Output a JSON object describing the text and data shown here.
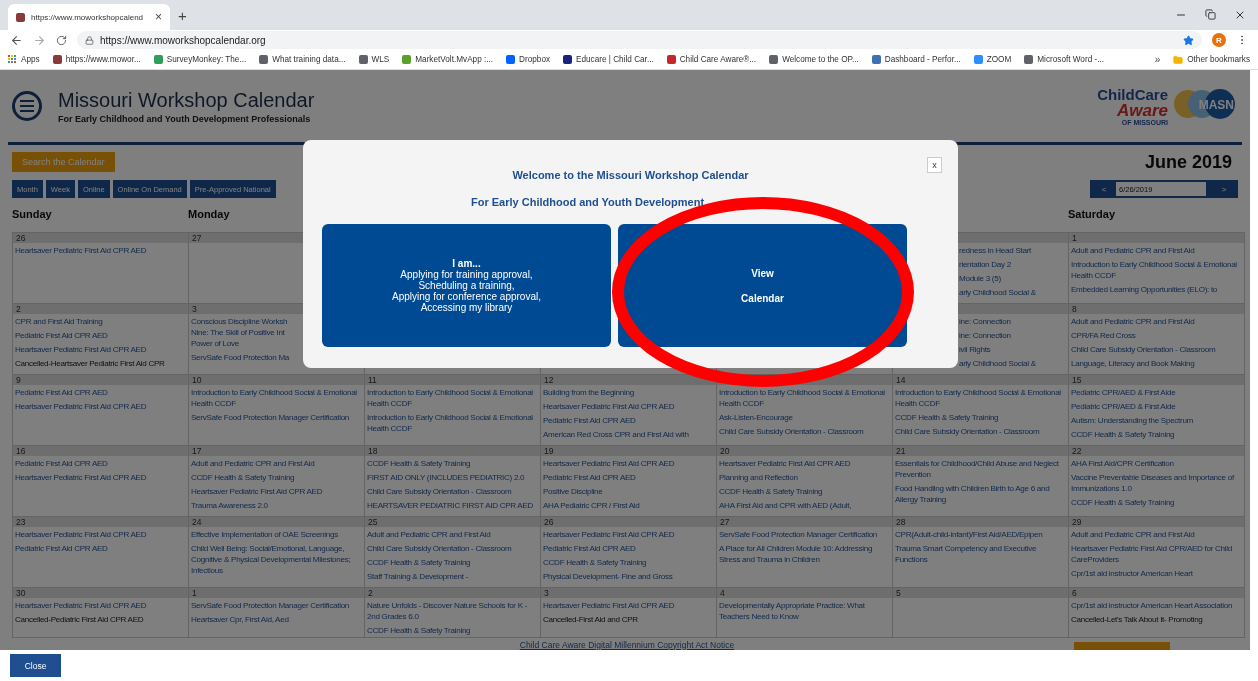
{
  "browser": {
    "tab_title": "https://www.moworkshopcalend",
    "tab_close": "×",
    "new_tab": "+",
    "url": "https://www.moworkshopcalendar.org",
    "avatar": "R",
    "apps": "Apps",
    "more": "»",
    "other_bookmarks": "Other bookmarks",
    "bookmarks": [
      {
        "label": "https://www.mowor...",
        "color": "#8a3a3a"
      },
      {
        "label": "SurveyMonkey: The...",
        "color": "#2e9e5a"
      },
      {
        "label": "What training data...",
        "color": "#5f6368"
      },
      {
        "label": "WLS",
        "color": "#5f6368"
      },
      {
        "label": "MarketVolt.MvApp :...",
        "color": "#5aa02c"
      },
      {
        "label": "Dropbox",
        "color": "#0061fe"
      },
      {
        "label": "Educare | Child Car...",
        "color": "#1a237e"
      },
      {
        "label": "Child Care Aware®...",
        "color": "#c62828"
      },
      {
        "label": "Welcome to the OP...",
        "color": "#5f6368"
      },
      {
        "label": "Dashboard - Perfor...",
        "color": "#3f6fb5"
      },
      {
        "label": "ZOOM",
        "color": "#2d8cff"
      },
      {
        "label": "Microsoft Word -...",
        "color": "#5f6368"
      }
    ]
  },
  "site": {
    "title": "Missouri Workshop Calendar",
    "subtitle": "For Early Childhood and Youth Development Professionals",
    "logo": {
      "brand_top": "ChildCare",
      "brand_bottom": "Aware",
      "brand_sub": "OF MISSOURI",
      "badge": "MASN"
    },
    "search_button": "Search the Calendar",
    "view_tabs": [
      "Month",
      "Week",
      "Online",
      "Online On Demand",
      "Pre-Approved National"
    ],
    "month": "June 2019",
    "nav": {
      "prev": "<",
      "date": "6/26/2019",
      "next": ">"
    },
    "headers_left": [
      "Sunday",
      "Monday"
    ],
    "headers_right": [
      "Saturday"
    ],
    "weeks": [
      {
        "cells": [
          {
            "day": "26",
            "events": [
              "Heartsaver Pediatric First Aid CPR AED"
            ]
          },
          {
            "day": "27"
          },
          {},
          {},
          {},
          {
            "partly_hidden": true,
            "events": [
              "redness in Head Start",
              "rientation Day 2",
              "Module 3 (5)",
              "arly Childhood Social &"
            ]
          },
          {
            "day": "1",
            "events": [
              "Adult and Pediatric CPR and First Aid",
              "Introduction to Early Childhood Social & Emotional Health CCDF",
              "Embedded Learning Opportunities (ELO): to"
            ]
          }
        ]
      },
      {
        "cells": [
          {
            "day": "2",
            "events": [
              "CPR and First Aid Training",
              "Pediatric First Aid CPR AED",
              "Heartsaver Pediatric First Aid CPR AED"
            ],
            "cancelled": [
              "Cancelled-Heartsaver Pediatric First Aid CPR"
            ]
          },
          {
            "day": "3",
            "events": [
              "Conscious Discipline Worksh\nNine: The Skill of Positive Int\nPower of Love",
              "ServSafe Food Protection Ma"
            ]
          },
          {},
          {},
          {},
          {
            "partly_hidden": true,
            "events": [
              "ine: Connection",
              "ine: Connection",
              "ivil Rights",
              "arly Childhood Social &"
            ]
          },
          {
            "day": "8",
            "events": [
              "Adult and Pediatric CPR and First Aid",
              "CPR/FA Red Cross",
              "Child Care Subsidy Orientation - Classroom",
              "Language, Literacy and Book Making"
            ]
          }
        ]
      },
      {
        "cells": [
          {
            "day": "9",
            "events": [
              "Pediatric First Aid CPR AED",
              "Heartsaver Pediatric First Aid CPR AED"
            ]
          },
          {
            "day": "10",
            "events": [
              "Introduction to Early Childhood Social & Emotional Health CCDF",
              "ServSafe Food Protection Manager Certification"
            ]
          },
          {
            "day": "11",
            "events": [
              "Introduction to Early Childhood Social & Emotional Health CCDF",
              "Introduction to Early Childhood Social & Emotional Health CCDF"
            ]
          },
          {
            "day": "12",
            "events": [
              "Building from the Beginning",
              "Heartsaver Pediatric First Aid CPR AED",
              "Pediatric First Aid CPR AED",
              "American Red Cross CPR and First Aid with"
            ]
          },
          {
            "events": [
              "Introduction to Early Childhood Social & Emotional Health CCDF",
              "Ask-Listen-Encourage",
              "Child Care Subsidy Orientation - Classroom"
            ]
          },
          {
            "day": "14",
            "events": [
              "Introduction to Early Childhood Social & Emotional Health CCDF",
              "CCDF Health & Safety Training",
              "Child Care Subsidy Orientation - Classroom"
            ]
          },
          {
            "day": "15",
            "events": [
              "Pediatric CPR/AED & First Aide",
              "Pediatric CPR/AED & First Aide",
              "Autism: Understanding the Spectrum",
              "CCDF Health & Safety Training"
            ]
          }
        ]
      },
      {
        "cells": [
          {
            "day": "16",
            "events": [
              "Pediatric First Aid CPR AED",
              "Heartsaver Pediatric First Aid CPR AED"
            ]
          },
          {
            "day": "17",
            "events": [
              "Adult and Pediatric CPR and First Aid",
              "CCDF Health & Safety Training",
              "Heartsaver Pediatric First Aid CPR AED",
              "Trauma Awareness 2.0"
            ]
          },
          {
            "day": "18",
            "events": [
              "CCDF Health & Safety Training",
              "FIRST AID ONLY (INCLUDES PEDIATRIC) 2.0",
              "Child Care Subsidy Orientation - Classroom",
              "HEARTSAVER PEDIATRIC FIRST AID CPR AED"
            ]
          },
          {
            "day": "19",
            "events": [
              "Heartsaver Pediatric First Aid CPR AED",
              "Pediatric First Aid CPR AED",
              "Positive Discipline",
              "AHA Pediatric CPR / First Aid"
            ]
          },
          {
            "day": "20",
            "events": [
              "Heartsaver Pediatric First Aid CPR AED",
              "Planning and Reflection",
              "CCDF Health & Safety Training",
              "AHA First Aid and CPR with AED (Adult,"
            ]
          },
          {
            "day": "21",
            "events": [
              "Essentials for Childhood/Child Abuse and Neglect Prevention",
              "Food Handling with Children Birth to Age 6 and Allergy Training"
            ]
          },
          {
            "day": "22",
            "events": [
              "AHA First Aid/CPR Certification",
              "Vaccine Preventable Diseases and Importance of Immunizations 1.0",
              "CCDF Health & Safety Training"
            ]
          }
        ]
      },
      {
        "cells": [
          {
            "day": "23",
            "events": [
              "Heartsaver Pediatric First Aid CPR AED",
              "Pediatric First Aid CPR AED"
            ]
          },
          {
            "day": "24",
            "events": [
              "Effective Implementation of OAE Screenings",
              "Child Well Being: Social/Emotional, Language, Cognitive & Physical Developmental Milestones; Infectious"
            ]
          },
          {
            "day": "25",
            "events": [
              "Adult and Pediatric CPR and First Aid",
              "Child Care Subsidy Orientation - Classroom",
              "CCDF Health & Safety Training",
              "Staff Training & Development -"
            ]
          },
          {
            "day": "26",
            "events": [
              "Heartsaver Pediatric First Aid CPR AED",
              "Pediatric First Aid CPR AED",
              "CCDF Health & Safety Training",
              "Physical Development- Fine and Gross"
            ]
          },
          {
            "day": "27",
            "events": [
              "ServSafe Food Protection Manager Certification",
              "A Place for All Children Module 10: Addressing Stress and Trauma in Children"
            ]
          },
          {
            "day": "28",
            "events": [
              "CPR(Adult-child-infant)/First Aid/AED/Epipen",
              "Trauma Smart Competency and Executive Functions"
            ]
          },
          {
            "day": "29",
            "events": [
              "Adult and Pediatric CPR and First Aid",
              "Heartsaver Pediatric First Aid CPR/AED for Child CareProviders",
              "Cpr/1st aid instructor American Heart"
            ]
          }
        ]
      },
      {
        "cells": [
          {
            "day": "30",
            "events": [
              "Heartsaver Pediatric First Aid CPR AED"
            ],
            "cancelled": [
              "Cancelled-Pediatric First Aid CPR AED"
            ]
          },
          {
            "day": "1",
            "events": [
              "ServSafe Food Protection Manager Certification",
              "Heartsaver Cpr, First Aid, Aed"
            ]
          },
          {
            "day": "2",
            "events": [
              "Nature Unfolds - Discover Nature Schools for K - 2nd Grades 6.0",
              "CCDF Health & Safety Training"
            ]
          },
          {
            "day": "3",
            "events": [
              "Heartsaver Pediatric First Aid CPR AED"
            ],
            "cancelled": [
              "Cancelled-First Aid and CPR"
            ]
          },
          {
            "day": "4",
            "events": [
              "Developmentally Appropriate Practice: What Teachers Need to Know"
            ]
          },
          {
            "day": "5"
          },
          {
            "day": "6",
            "events": [
              "Cpr/1st aid instructor American Heart Association"
            ],
            "cancelled": [
              "Cancelled-Let's Talk About It- Promoting"
            ]
          }
        ]
      }
    ],
    "footer_link": "Child Care Aware Digital Millennium Copyright Act Notice"
  },
  "modal": {
    "close": "x",
    "title": "Welcome to the Missouri Workshop Calendar",
    "subtitle": "For Early Childhood and Youth Development",
    "options": [
      {
        "kind": "list",
        "heading": "I am...",
        "lines": [
          "Applying for training approval,",
          "Scheduling a training,",
          "Applying for conference approval,",
          "Accessing my library"
        ]
      },
      {
        "kind": "label",
        "lines": [
          "View",
          "Calendar"
        ]
      }
    ]
  },
  "close_button": "Close"
}
